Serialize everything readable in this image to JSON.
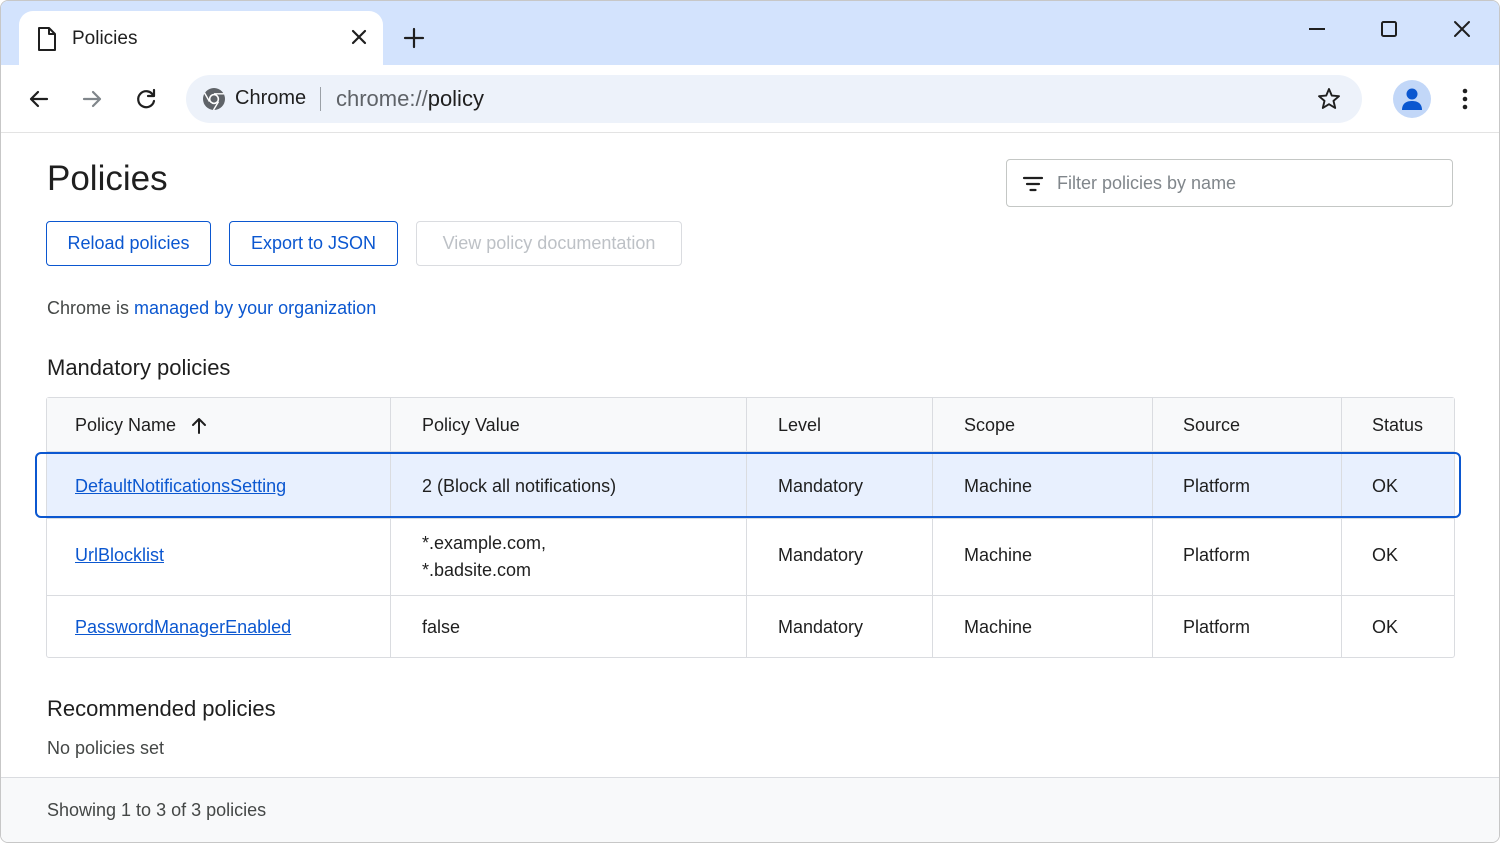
{
  "browser": {
    "tab": {
      "title": "Policies"
    },
    "chip_label": "Chrome",
    "url_scheme": "chrome://",
    "url_host": "policy",
    "icons": {
      "tab": "document-icon",
      "close": "close-icon",
      "new_tab": "plus-icon",
      "back": "arrow-back-icon",
      "forward": "arrow-forward-icon",
      "reload": "reload-icon",
      "bookmark": "star-icon",
      "menu": "more-vert-icon"
    }
  },
  "page": {
    "title": "Policies",
    "filter_placeholder": "Filter policies by name",
    "buttons": {
      "reload": "Reload policies",
      "export": "Export to JSON",
      "docs": "View policy documentation"
    },
    "managed_prefix": "Chrome is",
    "managed_link": "managed by your organization",
    "mandatory_title": "Mandatory policies",
    "table": {
      "columns": [
        "Policy Name",
        "Policy Value",
        "Level",
        "Scope",
        "Source",
        "Status"
      ],
      "sort_column": "Policy Name",
      "sort_direction": "ascending",
      "rows": [
        {
          "name": "DefaultNotificationsSetting",
          "value": [
            "2 (Block all notifications)"
          ],
          "level": "Mandatory",
          "scope": "Machine",
          "source": "Platform",
          "status": "OK",
          "selected": true
        },
        {
          "name": "UrlBlocklist",
          "value": [
            "*.example.com,",
            "*.badsite.com"
          ],
          "level": "Mandatory",
          "scope": "Machine",
          "source": "Platform",
          "status": "OK",
          "selected": false
        },
        {
          "name": "PasswordManagerEnabled",
          "value": [
            "false"
          ],
          "level": "Mandatory",
          "scope": "Machine",
          "source": "Platform",
          "status": "OK",
          "selected": false
        }
      ]
    },
    "recommended_title": "Recommended policies",
    "recommended_empty": "No policies set",
    "footer": "Showing 1 to 3 of 3 policies"
  },
  "colors": {
    "accent": "#0b57d0",
    "tabstrip": "#d3e3fd",
    "selected_row": "#e8f0fe"
  }
}
